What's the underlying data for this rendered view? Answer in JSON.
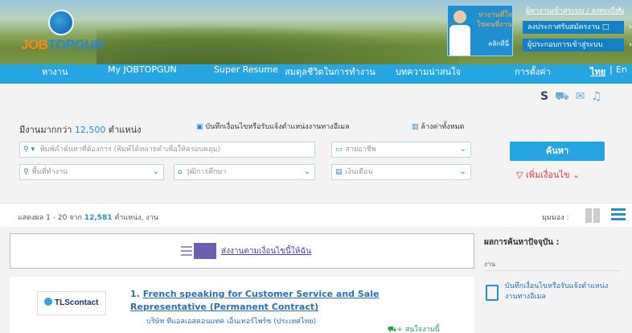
{
  "banner": {
    "logo_text_1": "JOB",
    "logo_text_2": "TOPGUN",
    "promo_line1": "หางานที่ใจ",
    "promo_line2": "ใช่คนที่งาน",
    "promo_click": "คลิกที่นี่",
    "toplinks": "ผู้หางานเข้าสู่ระบบ / ลงทะเบียน",
    "btn1": "ลงประกาศรับสมัครงาน",
    "btn2": "ผู้ประกอบการเข้าสู่ระบบ"
  },
  "nav": {
    "items": [
      "หางาน",
      "My JOBTOPGUN",
      "Super Resume",
      "สมดุลชีวิตในการทำงาน",
      "บทความน่าสนใจ",
      "การตั้งค่า"
    ],
    "lang_th": "ไทย",
    "lang_sep": "|",
    "lang_en": "En"
  },
  "search": {
    "count_prefix": "มีงานมากกว่า",
    "count_number": "12,500",
    "count_suffix": "ตำแหน่ง",
    "save_alert": "บันทึกเงื่อนไขหรือรับแจ้งตำแหน่งงานทางอีเมล",
    "clear_all": "ล้างค่าทั้งหมด",
    "keyword_placeholder": "พิมพ์คำค้นหาที่ต้องการ (พิมพ์ได้หลายคำเพื่อให้ครอบคลุม)",
    "occupation": "สายอาชีพ",
    "location": "พื้นที่ทำงาน",
    "education": "วุฒิการศึกษา",
    "salary": "เงินเดือน",
    "search_button": "ค้นหา",
    "more_filters": "เพิ่มเงื่อนไข"
  },
  "results": {
    "showing_prefix": "แสดงผล 1 - 20 จาก",
    "showing_total": "12,581",
    "showing_suffix": "ตำแหน่ง, งาน",
    "view_label": "มุมมอง :",
    "notify_text": "ส่งงานตามเงื่อนไขนี้ให้ฉัน"
  },
  "job": {
    "number": "1.",
    "title": "French speaking for Customer Service and Sale Representative (Permanent Contract)",
    "company": "บริษัท ทีแอลเอสคอนแทค เอ็นเทอร์ไพร์ซ (ประเทศไทย)",
    "company_logo": "TLScontact",
    "interest": "สนใจงานนี้"
  },
  "sidebar": {
    "title": "ผลการค้นหาปัจจุบัน :",
    "sub": "งาน",
    "save_alert": "บันทึกเงื่อนไขหรือรับแจ้งตำแหน่งงานทางอีเมล"
  }
}
